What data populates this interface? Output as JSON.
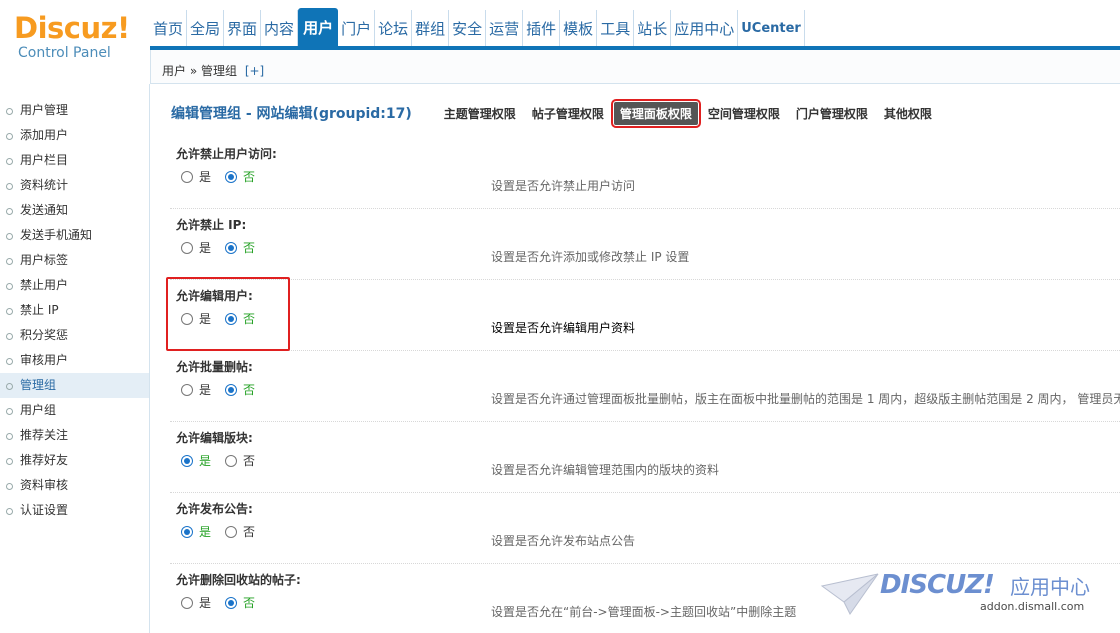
{
  "logo": {
    "main": "Discuz!",
    "sub": "Control Panel"
  },
  "nav": [
    "首页",
    "全局",
    "界面",
    "内容",
    "用户",
    "门户",
    "论坛",
    "群组",
    "安全",
    "运营",
    "插件",
    "模板",
    "工具",
    "站长",
    "应用中心",
    "UCenter"
  ],
  "nav_active": "用户",
  "breadcrumb": {
    "text": "用户 » 管理组",
    "plus": "[+]"
  },
  "sidebar": [
    "用户管理",
    "添加用户",
    "用户栏目",
    "资料统计",
    "发送通知",
    "发送手机通知",
    "用户标签",
    "禁止用户",
    "禁止 IP",
    "积分奖惩",
    "审核用户",
    "管理组",
    "用户组",
    "推荐关注",
    "推荐好友",
    "资料审核",
    "认证设置"
  ],
  "sidebar_active": "管理组",
  "page_title": "编辑管理组 - 网站编辑(groupid:17)",
  "tabs": [
    "主题管理权限",
    "帖子管理权限",
    "管理面板权限",
    "空间管理权限",
    "门户管理权限",
    "其他权限"
  ],
  "tab_active": "管理面板权限",
  "yes": "是",
  "no": "否",
  "settings": [
    {
      "label": "允许禁止用户访问:",
      "value": "否",
      "desc": "设置是否允许禁止用户访问"
    },
    {
      "label": "允许禁止 IP:",
      "value": "否",
      "desc": "设置是否允许添加或修改禁止 IP 设置"
    },
    {
      "label": "允许编辑用户:",
      "value": "否",
      "desc": "设置是否允许编辑用户资料"
    },
    {
      "label": "允许批量删帖:",
      "value": "否",
      "desc": "设置是否允许通过管理面板批量删帖，版主在面板中批量删帖的范围是 1 周内，超级版主删帖范围是 2 周内， 管理员无"
    },
    {
      "label": "允许编辑版块:",
      "value": "是",
      "desc": "设置是否允许编辑管理范围内的版块的资料"
    },
    {
      "label": "允许发布公告:",
      "value": "是",
      "desc": "设置是否允许发布站点公告"
    },
    {
      "label": "允许删除回收站的帖子:",
      "value": "否",
      "desc": "设置是否允在“前台->管理面板->主题回收站”中删除主题"
    }
  ],
  "watermark": {
    "brand": "DISCUZ!",
    "cn": "应用中心",
    "url": "addon.dismall.com"
  },
  "colors": {
    "accent": "#0f74b7",
    "logo": "#f79b20",
    "highlight": "#e02020",
    "selected_text": "#22a022"
  }
}
